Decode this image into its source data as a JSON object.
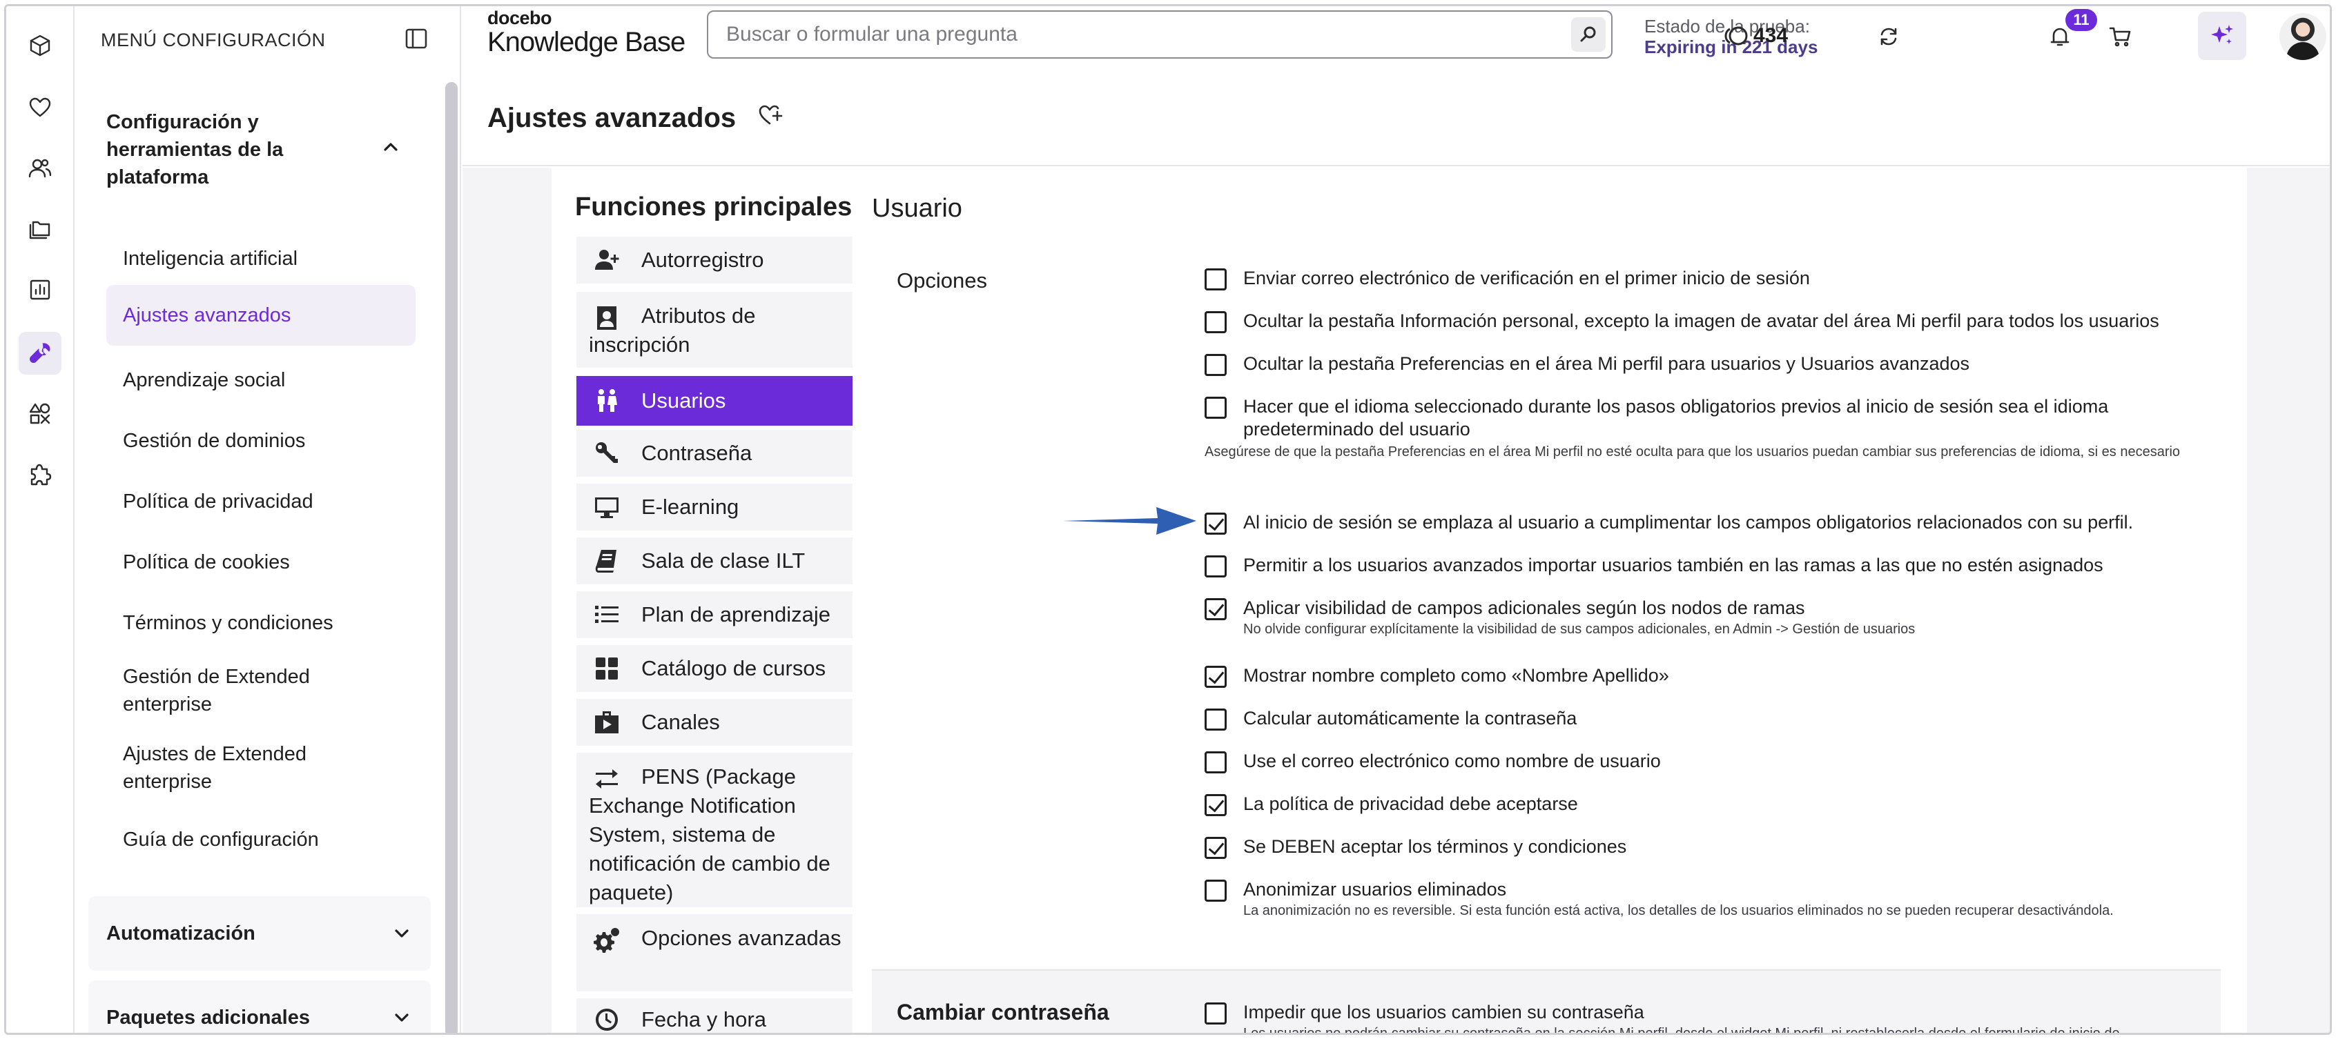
{
  "rail": {
    "items": [
      {
        "name": "cube-icon"
      },
      {
        "name": "heart-icon"
      },
      {
        "name": "people-icon"
      },
      {
        "name": "folders-icon"
      },
      {
        "name": "chart-icon"
      },
      {
        "name": "wrench-icon",
        "active": true
      },
      {
        "name": "apps-icon"
      },
      {
        "name": "puzzle-icon"
      }
    ]
  },
  "menu": {
    "header": "MENÚ CONFIGURACIÓN",
    "section_title": "Configuración y herramientas de la plataforma",
    "items": [
      {
        "label": "Inteligencia artificial"
      },
      {
        "label": "Ajustes avanzados",
        "active": true
      },
      {
        "label": "Aprendizaje social"
      },
      {
        "label": "Gestión de dominios"
      },
      {
        "label": "Política de privacidad"
      },
      {
        "label": "Política de cookies"
      },
      {
        "label": "Términos y condiciones"
      },
      {
        "label": "Gestión de Extended enterprise"
      },
      {
        "label": "Ajustes de Extended enterprise"
      },
      {
        "label": "Guía de configuración"
      }
    ],
    "accordions": [
      {
        "label": "Automatización"
      },
      {
        "label": "Paquetes adicionales"
      }
    ]
  },
  "topbar": {
    "logo_top": "docebo",
    "logo_bottom": "Knowledge Base",
    "search_placeholder": "Buscar o formular una pregunta",
    "trial_label": "Estado de la prueba:",
    "trial_value": "Expiring in 221 days",
    "credits": "434",
    "notifications": "11"
  },
  "page": {
    "title": "Ajustes avanzados"
  },
  "functions": {
    "title": "Funciones principales",
    "items": [
      {
        "label": "Autorregistro",
        "icon": "user-plus-icon"
      },
      {
        "label": "Atributos de inscripción",
        "icon": "id-card-icon"
      },
      {
        "label": "Usuarios",
        "icon": "users-icon",
        "active": true
      },
      {
        "label": "Contraseña",
        "icon": "key-icon"
      },
      {
        "label": "E-learning",
        "icon": "monitor-icon"
      },
      {
        "label": "Sala de clase ILT",
        "icon": "book-icon"
      },
      {
        "label": "Plan de aprendizaje",
        "icon": "list-icon"
      },
      {
        "label": "Catálogo de cursos",
        "icon": "grid-icon"
      },
      {
        "label": "Canales",
        "icon": "channels-icon"
      },
      {
        "label": "PENS (Package Exchange Notification System, sistema de notificación de cambio de paquete)",
        "icon": "exchange-icon"
      },
      {
        "label": "Opciones avanzadas",
        "icon": "gears-icon"
      },
      {
        "label": "Fecha y hora",
        "icon": "clock-icon"
      }
    ]
  },
  "usuario": {
    "title": "Usuario",
    "options_label": "Opciones",
    "options": [
      {
        "text": "Enviar correo electrónico de verificación en el primer inicio de sesión",
        "checked": false
      },
      {
        "text": "Ocultar la pestaña Información personal, excepto la imagen de avatar del área Mi perfil para todos los usuarios",
        "checked": false
      },
      {
        "text": "Ocultar la pestaña Preferencias en el área Mi perfil para usuarios y Usuarios avanzados",
        "checked": false
      },
      {
        "text": "Hacer que el idioma seleccionado durante los pasos obligatorios previos al inicio de sesión sea el idioma predeterminado del usuario",
        "checked": false,
        "note": "Asegúrese de que la pestaña Preferencias en el área Mi perfil no esté oculta para que los usuarios puedan cambiar sus preferencias de idioma, si es necesario"
      },
      {
        "text": "Al inicio de sesión se emplaza al usuario a cumplimentar los campos obligatorios relacionados con su perfil.",
        "checked": true
      },
      {
        "text": "Permitir a los usuarios avanzados importar usuarios también en las ramas a las que no estén asignados",
        "checked": false
      },
      {
        "text": "Aplicar visibilidad de campos adicionales según los nodos de ramas",
        "checked": true,
        "note": "No olvide configurar explícitamente la visibilidad de sus campos adicionales, en Admin -> Gestión de usuarios"
      },
      {
        "text": "Mostrar nombre completo como «Nombre Apellido»",
        "checked": true
      },
      {
        "text": "Calcular automáticamente la contraseña",
        "checked": false
      },
      {
        "text": "Use el correo electrónico como nombre de usuario",
        "checked": false
      },
      {
        "text": "La política de privacidad debe aceptarse",
        "checked": true
      },
      {
        "text": "Se DEBEN aceptar los términos y condiciones",
        "checked": true
      },
      {
        "text": "Anonimizar usuarios eliminados",
        "checked": false,
        "note": "La anonimización no es reversible. Si esta función está activa, los detalles de los usuarios eliminados no se pueden recuperar desactivándola."
      }
    ],
    "password_section": {
      "label": "Cambiar contraseña",
      "option": {
        "text": "Impedir que los usuarios cambien su contraseña",
        "checked": false
      },
      "note": "Los usuarios no podrán cambiar su contraseña en la sección Mi perfil, desde el widget Mi perfil, ni restablecerla desde el formulario de inicio de"
    }
  },
  "colors": {
    "accent": "#6c2bd9",
    "arrow": "#2f5fb3"
  }
}
